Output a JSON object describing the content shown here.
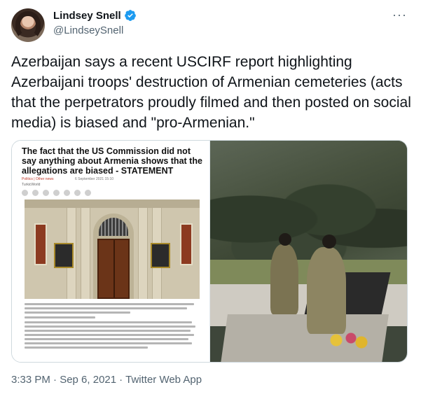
{
  "tweet": {
    "display_name": "Lindsey Snell",
    "handle": "@LindseySnell",
    "more_label": "···",
    "text": "Azerbaijan says a recent USCIRF report highlighting Azerbaijani troops' destruction of Armenian cemeteries (acts that the perpetrators proudly filmed and then posted on social media) is biased and \"pro-Armenian.\"",
    "timestamp": "3:33 PM · Sep 6, 2021",
    "separator": "·",
    "client": "Twitter Web App"
  },
  "article": {
    "headline": "The fact that the US Commission did not say anything about Armenia shows that the allegations are biased - STATEMENT",
    "category": "Politics | Other news",
    "date": "6 September 2021 15:10",
    "source": "TurkicWorld"
  },
  "colors": {
    "verified": "#1d9bf0",
    "text": "#0f1419",
    "secondary": "#536471"
  },
  "icons": [
    "verified-badge-icon",
    "more-options-icon"
  ]
}
